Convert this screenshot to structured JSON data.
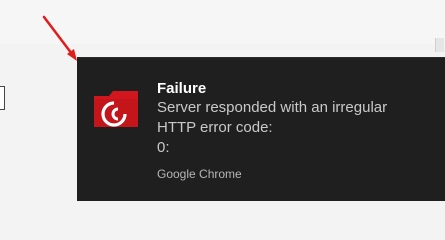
{
  "notification": {
    "icon": "bittorrent-folder-icon",
    "title": "Failure",
    "message_lines": [
      "Server responded with an irregular",
      "HTTP error code:",
      "0:"
    ],
    "source": "Google Chrome"
  },
  "annotation": {
    "arrow_icon": "red-arrow-icon",
    "color": "#e21b1b"
  },
  "colors": {
    "toast_background": "#1f1f1f",
    "icon_red": "#d1171d"
  }
}
